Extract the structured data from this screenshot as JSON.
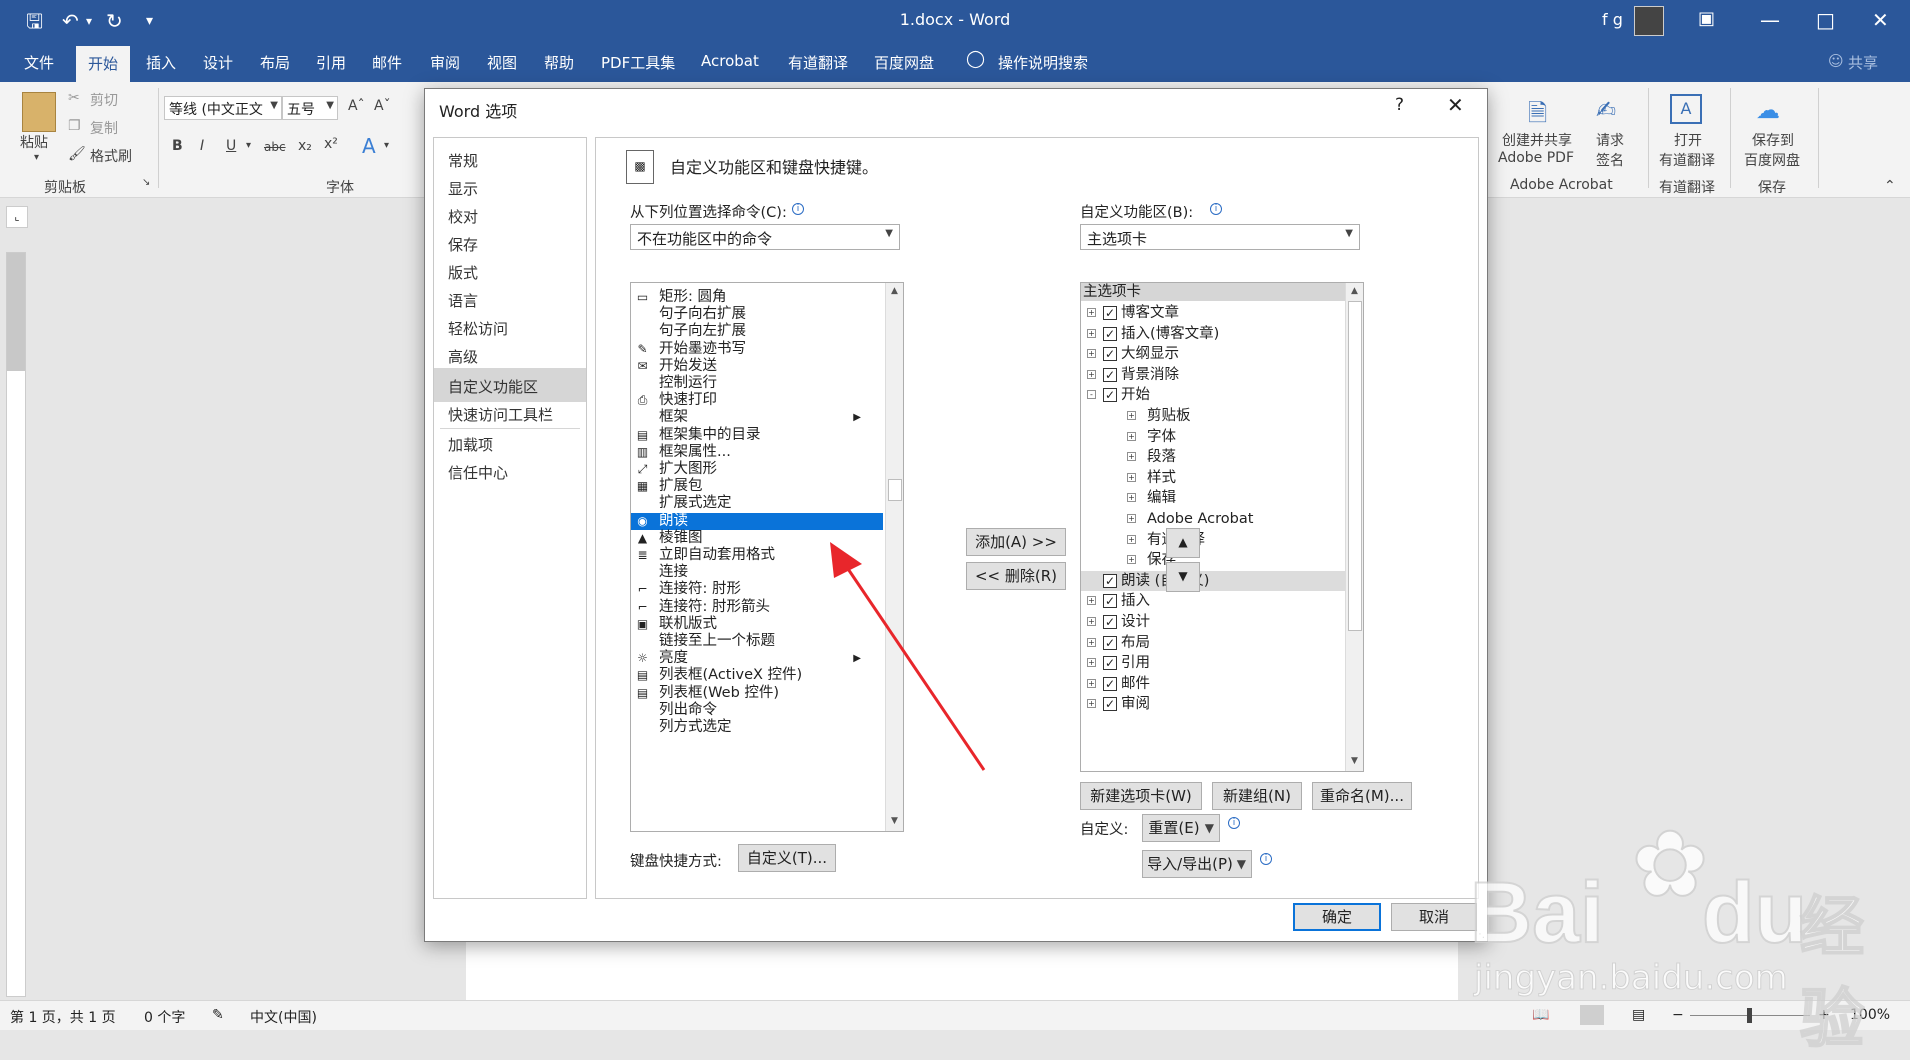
{
  "window": {
    "title": "1.docx  -  Word",
    "user": "f g"
  },
  "tabs": [
    "文件",
    "开始",
    "插入",
    "设计",
    "布局",
    "引用",
    "邮件",
    "审阅",
    "视图",
    "帮助",
    "PDF工具集",
    "Acrobat",
    "有道翻译",
    "百度网盘",
    "操作说明搜索"
  ],
  "share": "共享",
  "ribbon": {
    "paste": "粘贴",
    "cut": "剪切",
    "copy": "复制",
    "format_painter": "格式刷",
    "clipboard_group": "剪贴板",
    "font_name": "等线 (中文正文",
    "font_size": "五号",
    "font_group": "字体",
    "create_share_pdf": [
      "创建并共享",
      "Adobe PDF"
    ],
    "request_sign": [
      "请求",
      "签名"
    ],
    "adobe_group": "Adobe Acrobat",
    "open_translate": [
      "打开",
      "有道翻译"
    ],
    "youdao_group": "有道翻译",
    "save_baidu": [
      "保存到",
      "百度网盘"
    ],
    "save_group": "保存"
  },
  "dialog": {
    "title": "Word 选项",
    "help": "?",
    "nav": [
      "常规",
      "显示",
      "校对",
      "保存",
      "版式",
      "语言",
      "轻松访问",
      "高级",
      "自定义功能区",
      "快速访问工具栏",
      "加载项",
      "信任中心"
    ],
    "selected_nav": "自定义功能区",
    "heading": "自定义功能区和键盘快捷键。",
    "choose_label": "从下列位置选择命令(C):",
    "choose_value": "不在功能区中的命令",
    "customize_label": "自定义功能区(B):",
    "customize_value": "主选项卡",
    "commands": [
      {
        "label": "矩形: 圆角",
        "icon": "rect-icon"
      },
      {
        "label": "句子向右扩展",
        "icon": ""
      },
      {
        "label": "句子向左扩展",
        "icon": ""
      },
      {
        "label": "开始墨迹书写",
        "icon": "ink-icon"
      },
      {
        "label": "开始发送",
        "icon": "send-icon"
      },
      {
        "label": "控制运行",
        "icon": ""
      },
      {
        "label": "快速打印",
        "icon": "print-icon"
      },
      {
        "label": "框架",
        "icon": "",
        "submenu": true
      },
      {
        "label": "框架集中的目录",
        "icon": "toc-icon"
      },
      {
        "label": "框架属性...",
        "icon": "frame-icon"
      },
      {
        "label": "扩大图形",
        "icon": "enlarge-icon"
      },
      {
        "label": "扩展包",
        "icon": "pack-icon"
      },
      {
        "label": "扩展式选定",
        "icon": ""
      },
      {
        "label": "朗读",
        "icon": "speak-icon",
        "selected": true
      },
      {
        "label": "棱锥图",
        "icon": "pyramid-icon"
      },
      {
        "label": "立即自动套用格式",
        "icon": "autoformat-icon"
      },
      {
        "label": "连接",
        "icon": ""
      },
      {
        "label": "连接符: 肘形",
        "icon": "elbow-icon"
      },
      {
        "label": "连接符: 肘形箭头",
        "icon": "elbow-arrow-icon"
      },
      {
        "label": "联机版式",
        "icon": "web-layout-icon"
      },
      {
        "label": "链接至上一个标题",
        "icon": ""
      },
      {
        "label": "亮度",
        "icon": "brightness-icon",
        "submenu": true
      },
      {
        "label": "列表框(ActiveX 控件)",
        "icon": "listbox-icon"
      },
      {
        "label": "列表框(Web 控件)",
        "icon": "listbox-icon"
      },
      {
        "label": "列出命令",
        "icon": ""
      },
      {
        "label": "列方式选定",
        "icon": ""
      }
    ],
    "add_button": "添加(A) >>",
    "remove_button": "<< 删除(R)",
    "tree_header": "主选项卡",
    "tree": [
      {
        "label": "博客文章",
        "level": 0,
        "check": true,
        "exp": "+"
      },
      {
        "label": "插入(博客文章)",
        "level": 0,
        "check": true,
        "exp": "+"
      },
      {
        "label": "大纲显示",
        "level": 0,
        "check": true,
        "exp": "+"
      },
      {
        "label": "背景消除",
        "level": 0,
        "check": true,
        "exp": "+"
      },
      {
        "label": "开始",
        "level": 0,
        "check": true,
        "exp": "-"
      },
      {
        "label": "剪贴板",
        "level": 1,
        "exp": "+"
      },
      {
        "label": "字体",
        "level": 1,
        "exp": "+"
      },
      {
        "label": "段落",
        "level": 1,
        "exp": "+"
      },
      {
        "label": "样式",
        "level": 1,
        "exp": "+"
      },
      {
        "label": "编辑",
        "level": 1,
        "exp": "+"
      },
      {
        "label": "Adobe Acrobat",
        "level": 1,
        "exp": "+"
      },
      {
        "label": "有道翻译",
        "level": 1,
        "exp": "+"
      },
      {
        "label": "保存",
        "level": 1,
        "exp": "+"
      },
      {
        "label": "朗读 (自定义)",
        "level": 0,
        "check": true,
        "exp": "",
        "selected": true
      },
      {
        "label": "插入",
        "level": 0,
        "check": true,
        "exp": "+"
      },
      {
        "label": "设计",
        "level": 0,
        "check": true,
        "exp": "+"
      },
      {
        "label": "布局",
        "level": 0,
        "check": true,
        "exp": "+"
      },
      {
        "label": "引用",
        "level": 0,
        "check": true,
        "exp": "+"
      },
      {
        "label": "邮件",
        "level": 0,
        "check": true,
        "exp": "+"
      },
      {
        "label": "审阅",
        "level": 0,
        "check": true,
        "exp": "+"
      }
    ],
    "new_tab": "新建选项卡(W)",
    "new_group": "新建组(N)",
    "rename": "重命名(M)...",
    "customize": "自定义:",
    "reset": "重置(E)",
    "import_export": "导入/导出(P)",
    "keyboard_label": "键盘快捷方式:",
    "keyboard_button": "自定义(T)...",
    "ok": "确定",
    "cancel": "取消"
  },
  "status": {
    "page": "第 1 页，共 1 页",
    "words": "0 个字",
    "language": "中文(中国)",
    "zoom": "100%"
  },
  "watermark": {
    "brand": "Bai",
    "du": "du",
    "jy": "经验",
    "url": "jingyan.baidu.com"
  },
  "colors": {
    "accent": "#2b579a",
    "selection": "#0a73d9",
    "arrow": "#e8262b"
  }
}
